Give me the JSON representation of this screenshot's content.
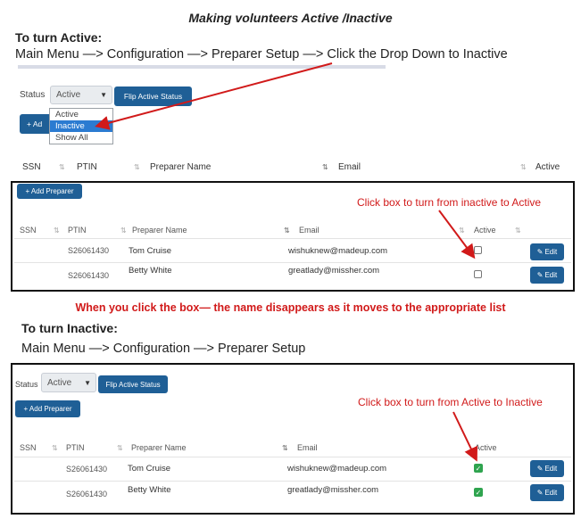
{
  "title": "Making volunteers Active /Inactive",
  "active_section": {
    "heading": "To turn Active:",
    "path": "Main Menu —> Configuration —> Preparer Setup —> Click the Drop Down to Inactive"
  },
  "filter_top": {
    "status_label": "Status",
    "select_value": "Active",
    "flip_button": "Flip Active Status",
    "add_button": "+ Ad",
    "dropdown_options": [
      "Active",
      "Inactive",
      "Show All"
    ],
    "dropdown_selected": "Inactive"
  },
  "top_headers": [
    "SSN",
    "PTIN",
    "Preparer Name",
    "Email",
    "Active"
  ],
  "panel1": {
    "add_button": "+ Add Preparer",
    "callout": "Click box to turn from inactive to Active",
    "headers": [
      "SSN",
      "PTIN",
      "Preparer Name",
      "Email",
      "Active"
    ],
    "rows": [
      {
        "ptin": "S26061430",
        "name": "Tom Cruise",
        "email": "wishuknew@madeup.com",
        "active": false,
        "edit": "Edit"
      },
      {
        "ptin": "S26061430",
        "name": "Betty White",
        "email": "greatlady@missher.com",
        "active": false,
        "edit": "Edit"
      }
    ]
  },
  "note": "When you click the box— the name disappears as it moves to the appropriate list",
  "inactive_section": {
    "heading": "To turn Inactive:",
    "path": "Main Menu —> Configuration —> Preparer Setup"
  },
  "panel2": {
    "status_label": "Status",
    "select_value": "Active",
    "flip_button": "Flip Active Status",
    "add_button": "+ Add Preparer",
    "callout": "Click box to turn from Active to Inactive",
    "headers": [
      "SSN",
      "PTIN",
      "Preparer Name",
      "Email",
      "Active"
    ],
    "rows": [
      {
        "ptin": "S26061430",
        "name": "Tom Cruise",
        "email": "wishuknew@madeup.com",
        "active": true,
        "edit": "Edit"
      },
      {
        "ptin": "S26061430",
        "name": "Betty White",
        "email": "greatlady@missher.com",
        "active": true,
        "edit": "Edit"
      }
    ]
  },
  "colors": {
    "accent": "#1f5f96",
    "annotation": "#d11a1a",
    "checked": "#2fa44f",
    "dropdown_highlight": "#2b7bd1"
  },
  "icons": {
    "sort": "sort-arrows-icon",
    "edit": "pencil-icon",
    "check": "check-icon",
    "caret": "chevron-down-icon",
    "plus": "plus-icon"
  }
}
